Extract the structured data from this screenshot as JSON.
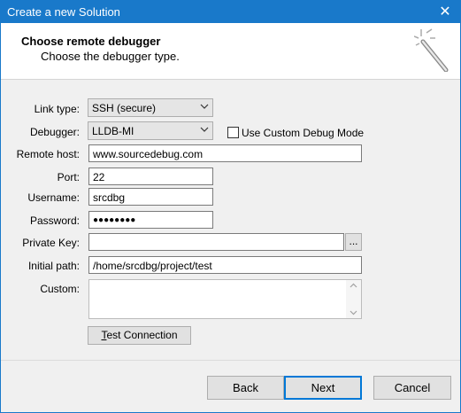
{
  "window": {
    "title": "Create a new Solution",
    "close_glyph": "✕",
    "accent": "#1979ca"
  },
  "header": {
    "title": "Choose remote debugger",
    "subtitle": "Choose the debugger type.",
    "icon": "magic-wand-icon"
  },
  "form": {
    "link_type": {
      "label": "Link type:",
      "value": "SSH (secure)"
    },
    "debugger": {
      "label": "Debugger:",
      "value": "LLDB-MI"
    },
    "custom_debug_mode": {
      "label": "Use Custom Debug Mode",
      "checked": false
    },
    "remote_host": {
      "label": "Remote host:",
      "value": "www.sourcedebug.com"
    },
    "port": {
      "label": "Port:",
      "value": "22"
    },
    "username": {
      "label": "Username:",
      "value": "srcdbg"
    },
    "password": {
      "label": "Password:",
      "value": "●●●●●●●●"
    },
    "private_key": {
      "label": "Private Key:",
      "value": "",
      "browse_label": "..."
    },
    "initial_path": {
      "label": "Initial path:",
      "value": "/home/srcdbg/project/test"
    },
    "custom": {
      "label": "Custom:",
      "value": ""
    }
  },
  "test_connection": {
    "mnemonic": "T",
    "rest": "est Connection"
  },
  "footer": {
    "back": "Back",
    "next": "Next",
    "cancel": "Cancel"
  }
}
